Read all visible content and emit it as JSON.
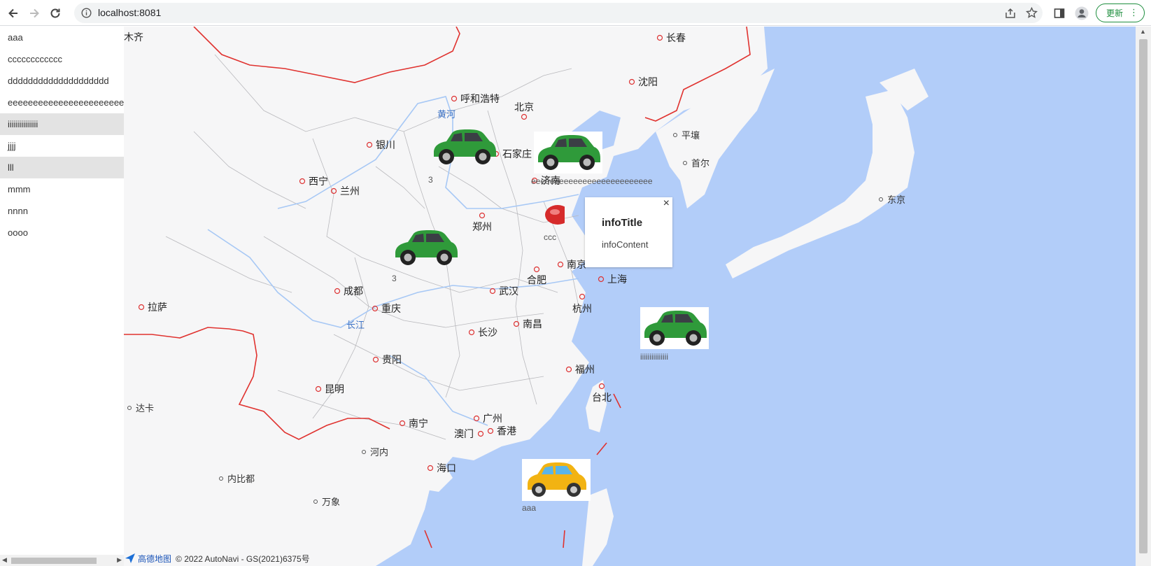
{
  "browser": {
    "url": "localhost:8081",
    "update_label": "更新"
  },
  "sidebar": {
    "items": [
      {
        "label": "aaa",
        "selected": false
      },
      {
        "label": "cccccccccccc",
        "selected": false
      },
      {
        "label": "dddddddddddddddddddd",
        "selected": false
      },
      {
        "label": "eeeeeeeeeeeeeeeeeeeeeeee",
        "selected": false
      },
      {
        "label": "iiiiiiiiiiiiiii",
        "selected": true
      },
      {
        "label": "jjjj",
        "selected": false
      },
      {
        "label": "lll",
        "selected": true
      },
      {
        "label": "mmm",
        "selected": false
      },
      {
        "label": "nnnn",
        "selected": false
      },
      {
        "label": "oooo",
        "selected": false
      }
    ]
  },
  "map": {
    "cities": {
      "wulumuqi": "木齐",
      "changchun": "长春",
      "shenyang": "沈阳",
      "huhehaote": "呼和浩特",
      "beijing": "北京",
      "yinchuan": "银川",
      "shijiazhuang": "石家庄",
      "xining": "西宁",
      "lanzhou": "兰州",
      "jinan": "济南",
      "zhengzhou": "郑州",
      "nanjing": "南京",
      "hefei": "合肥",
      "shanghai": "上海",
      "chengdu": "成都",
      "wuhan": "武汉",
      "hangzhou": "杭州",
      "lasa": "拉萨",
      "chongqing": "重庆",
      "nanchang": "南昌",
      "changsha": "长沙",
      "guiyang": "贵阳",
      "fuzhou": "福州",
      "taibei": "台北",
      "kunming": "昆明",
      "guangzhou": "广州",
      "nanning": "南宁",
      "aomen": "澳门",
      "xianggang": "香港",
      "haikou": "海口",
      "pingrang": "平壤",
      "shouer": "首尔",
      "dongjing": "东京",
      "daka": "达卡",
      "henei": "河内",
      "neibidu": "内比都",
      "wanxiang": "万象"
    },
    "rivers": {
      "huanghe": "黄河",
      "changjiang": "长江"
    },
    "markers": [
      {
        "name": "green-car",
        "label": "3"
      },
      {
        "name": "green-car",
        "label": "eeeeeeeeeeeeeeeeeeeeeeeeee"
      },
      {
        "name": "green-car",
        "label": "3"
      },
      {
        "name": "red-marker",
        "label": "ccc"
      },
      {
        "name": "green-car",
        "label": "iiiiiiiiiiiiiii"
      },
      {
        "name": "yellow-taxi",
        "label": "aaa"
      }
    ],
    "info_window": {
      "title": "infoTitle",
      "content": "infoContent",
      "close_label": "×"
    },
    "attribution": {
      "logo_text": "高德地图",
      "copyright": "© 2022 AutoNavi - GS(2021)6375号"
    }
  },
  "colors": {
    "sea": "#b2cdf9",
    "land": "#f6f6f7",
    "border": "#e0322f",
    "river": "#a7c8f5",
    "green_car": "#2f9a3a",
    "taxi": "#f2b312"
  }
}
